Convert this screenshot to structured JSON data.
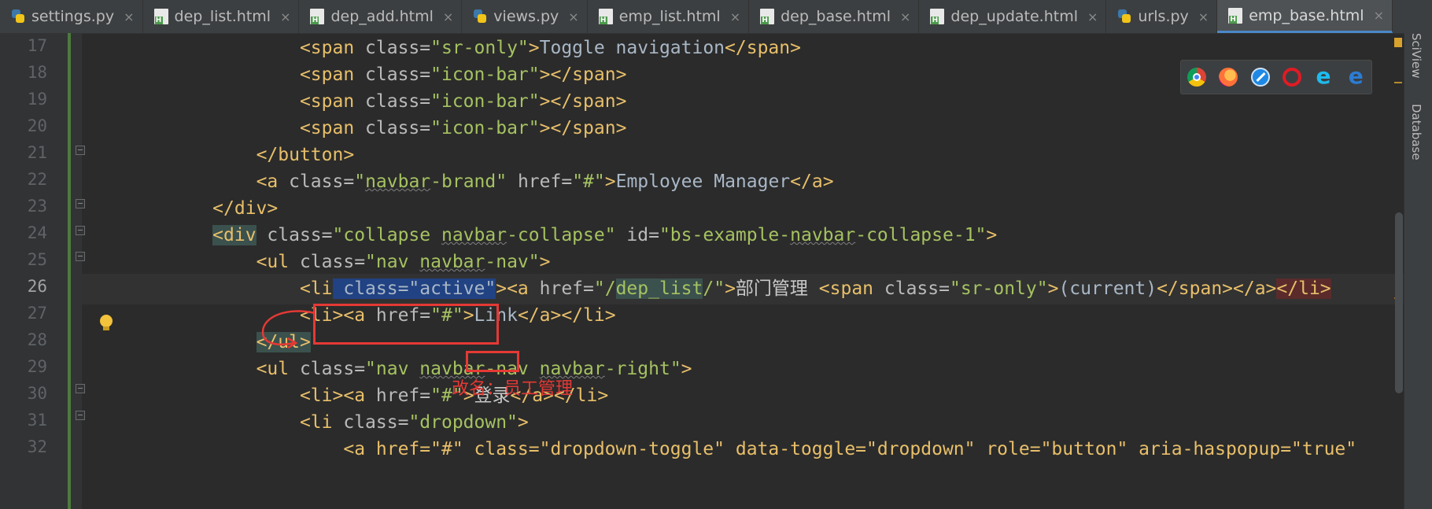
{
  "tabs": [
    {
      "label": "settings.py",
      "type": "py",
      "active": false
    },
    {
      "label": "dep_list.html",
      "type": "html",
      "active": false
    },
    {
      "label": "dep_add.html",
      "type": "html",
      "active": false
    },
    {
      "label": "views.py",
      "type": "py",
      "active": false
    },
    {
      "label": "emp_list.html",
      "type": "html",
      "active": false
    },
    {
      "label": "dep_base.html",
      "type": "html",
      "active": false
    },
    {
      "label": "dep_update.html",
      "type": "html",
      "active": false
    },
    {
      "label": "urls.py",
      "type": "py",
      "active": false
    },
    {
      "label": "emp_base.html",
      "type": "html",
      "active": true
    }
  ],
  "tab_close_glyph": "×",
  "line_numbers": [
    "17",
    "18",
    "19",
    "20",
    "21",
    "22",
    "23",
    "24",
    "25",
    "26",
    "27",
    "28",
    "29",
    "30",
    "31",
    "32"
  ],
  "current_line": "26",
  "code": {
    "l17": {
      "open": "<span ",
      "attr": "class=",
      "val": "\"sr-only\"",
      "gt": ">",
      "text": "Toggle navigation",
      "close": "</span>"
    },
    "l18": {
      "open": "<span ",
      "attr": "class=",
      "val": "\"icon-bar\"",
      "gt": ">",
      "close": "</span>"
    },
    "l19": {
      "open": "<span ",
      "attr": "class=",
      "val": "\"icon-bar\"",
      "gt": ">",
      "close": "</span>"
    },
    "l20": {
      "open": "<span ",
      "attr": "class=",
      "val": "\"icon-bar\"",
      "gt": ">",
      "close": "</span>"
    },
    "l21": {
      "close": "</button>"
    },
    "l22": {
      "open": "<a ",
      "attr1": "class=",
      "q1": "\"",
      "val1": "navbar",
      "val1b": "-brand\"",
      "attr2": " href=",
      "val2": "\"#\"",
      "gt": ">",
      "text": "Employee Manager",
      "close": "</a>"
    },
    "l23": {
      "close": "</div>"
    },
    "l24": {
      "open": "<div",
      "attr1": " class=",
      "val1a": "\"collapse ",
      "val1b": "navbar",
      "val1c": "-collapse\"",
      "attr2": " id=",
      "val2a": "\"bs-example-",
      "val2b": "navbar",
      "val2c": "-collapse-1\"",
      "gt": ">"
    },
    "l25": {
      "open": "<ul",
      "attr": " class=",
      "val1": "\"nav ",
      "val2": "navbar",
      "val3": "-nav\"",
      "gt": ">"
    },
    "l26": {
      "open": "<li",
      "sel": " class=\"active\"",
      "gt": ">",
      "a_open": "<a ",
      "attr": "href=",
      "q": "\"/",
      "href": "dep_list",
      "q2": "/\"",
      "gt2": ">",
      "text": "部门管理",
      "sp": " ",
      "span_open": "<span ",
      "span_attr": "class=",
      "span_val": "\"sr-only\"",
      "gt3": ">",
      "span_text": "(current)",
      "span_close": "</span>",
      "a_close": "</a>",
      "li_close": "</li>"
    },
    "l27": {
      "open": "<li>",
      "a_open": "<a ",
      "attr": "href=",
      "val": "\"#\"",
      "gt": ">",
      "text": "Link",
      "close": "</a></li>"
    },
    "l28": {
      "close": "</ul>"
    },
    "l29": {
      "open": "<ul",
      "attr": " class=",
      "val1": "\"nav ",
      "val2": "navbar",
      "val3": "-nav ",
      "val4": "navbar",
      "val5": "-right\"",
      "gt": ">"
    },
    "l30": {
      "open": "<li>",
      "a_open": "<a ",
      "attr": "href=",
      "val": "\"#\"",
      "gt": ">",
      "text": "登录",
      "close": "</a></li>"
    },
    "l31": {
      "open": "<li ",
      "attr": "class=",
      "val": "\"dropdown\"",
      "gt": ">"
    },
    "l32": {
      "text": "<a href=\"#\" class=\"dropdown-toggle\" data-toggle=\"dropdown\" role=\"button\" aria-haspopup=\"true\""
    }
  },
  "annotation": {
    "rename_note": "改名：员工管理"
  },
  "browsers": [
    "chrome-icon",
    "firefox-icon",
    "safari-icon",
    "opera-icon",
    "ie-icon",
    "edge-icon"
  ],
  "side_tools": {
    "sciview": "SciView",
    "database": "Database"
  },
  "colors": {
    "tag": "#e8bf6a",
    "attr_name": "#bababa",
    "attr_value": "#a5c261",
    "selection": "#214283",
    "annotation": "#e53935"
  }
}
